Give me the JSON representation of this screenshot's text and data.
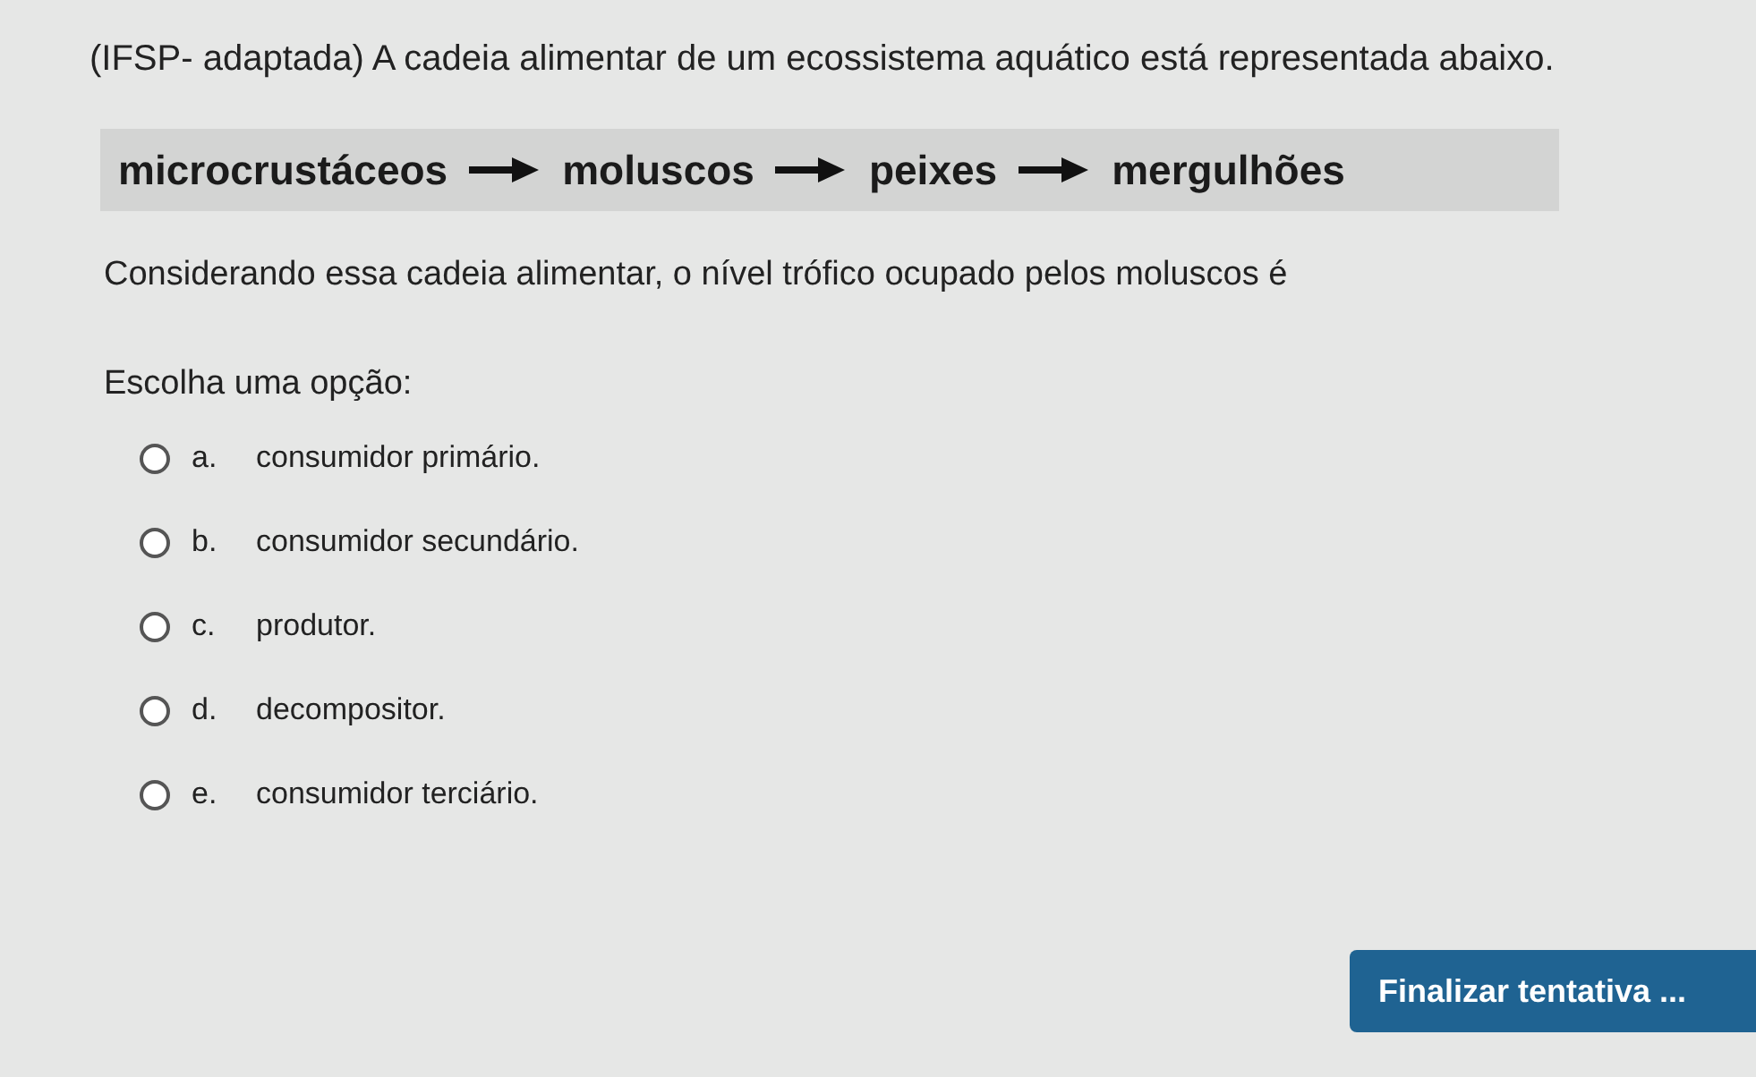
{
  "question": {
    "source": "(IFSP- adaptada) A cadeia alimentar de um ecossistema aquático está representada abaixo.",
    "chain": [
      "microcrustáceos",
      "moluscos",
      "peixes",
      "mergulhões"
    ],
    "prompt": "Considerando essa cadeia alimentar, o nível trófico ocupado pelos moluscos é"
  },
  "choose_label": "Escolha uma opção:",
  "options": [
    {
      "letter": "a.",
      "text": "consumidor primário.",
      "selected": false
    },
    {
      "letter": "b.",
      "text": "consumidor secundário.",
      "selected": false
    },
    {
      "letter": "c.",
      "text": "produtor.",
      "selected": false
    },
    {
      "letter": "d.",
      "text": "decompositor.",
      "selected": false
    },
    {
      "letter": "e.",
      "text": "consumidor terciário.",
      "selected": false
    }
  ],
  "finish_button": "Finalizar tentativa ..."
}
